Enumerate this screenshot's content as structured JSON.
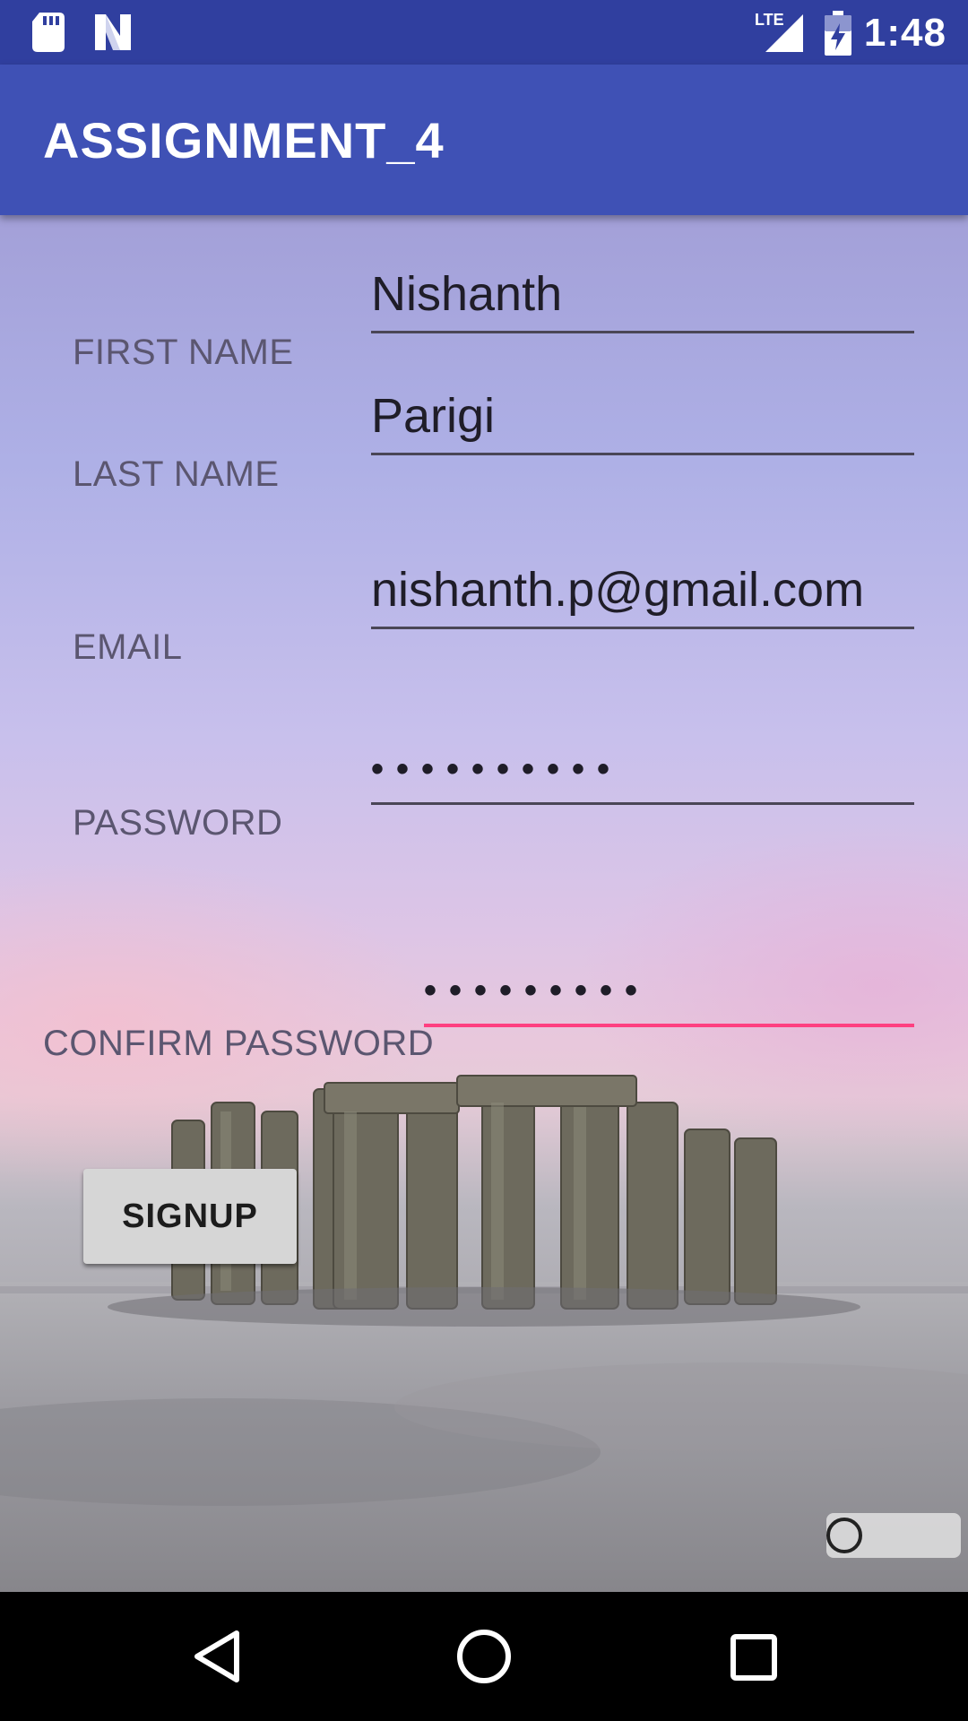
{
  "status_bar": {
    "time": "1:48",
    "network": "LTE",
    "icons": [
      "sd-card-icon",
      "notification-n-icon",
      "lte-signal-icon",
      "battery-charging-icon"
    ]
  },
  "app_bar": {
    "title": "ASSIGNMENT_4"
  },
  "form": {
    "first_name": {
      "label": "FIRST NAME",
      "value": "Nishanth"
    },
    "last_name": {
      "label": "LAST NAME",
      "value": "Parigi"
    },
    "email": {
      "label": "EMAIL",
      "value": "nishanth.p@gmail.com"
    },
    "password": {
      "label": "PASSWORD",
      "value": "••••••••••"
    },
    "confirm_password": {
      "label": "CONFIRM PASSWORD",
      "value": "•••••••••"
    },
    "signup_label": "SIGNUP"
  },
  "nav_bar": {
    "icons": [
      "back-icon",
      "home-icon",
      "recents-icon"
    ]
  },
  "colors": {
    "status_bar": "#303f9f",
    "app_bar": "#3f51b5",
    "accent": "#ff4081",
    "button_bg": "#d6d6d6"
  }
}
